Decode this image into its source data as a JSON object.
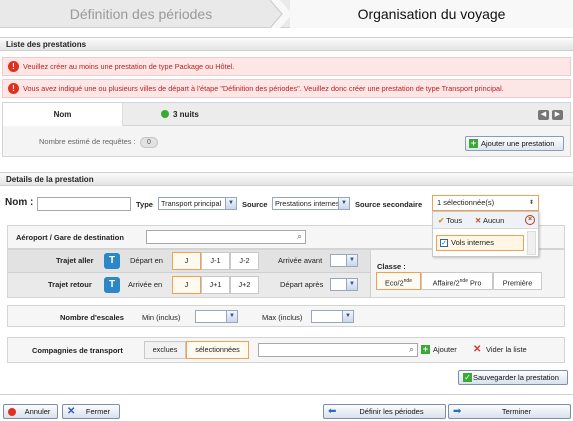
{
  "wizard": {
    "step1": "Définition des périodes",
    "step2": "Organisation du voyage"
  },
  "prestations": {
    "title": "Liste des prestations",
    "alert1": "Veuillez créer au moins une prestation de type Package ou Hôtel.",
    "alert2": "Vous avez indiqué une ou plusieurs villes de départ à l'étape \"Définition des périodes\". Veuillez donc créer une prestation de type Transport principal.",
    "col_nom": "Nom",
    "col_nuits": "3 nuits",
    "requetes_label": "Nombre estimé de requêtes :",
    "requetes_value": "0",
    "add_button": "Ajouter une prestation"
  },
  "details": {
    "title": "Details de la prestation",
    "nom_label": "Nom :",
    "nom_value": "",
    "type_label": "Type",
    "type_value": "Transport principal",
    "source_label": "Source",
    "source_value": "Prestations internes",
    "source2_label": "Source secondaire",
    "source2_value": "1 sélectionnée(s)",
    "dropdown": {
      "tous": "Tous",
      "aucun": "Aucun",
      "option1": "Vols internes"
    }
  },
  "aeroport": {
    "label": "Aéroport / Gare de destination",
    "value": ""
  },
  "trajet": {
    "aller_label": "Trajet aller",
    "retour_label": "Trajet retour",
    "depart_en": "Départ en",
    "arrivee_en": "Arrivée en",
    "aller_tabs": [
      "J",
      "J-1",
      "J-2"
    ],
    "retour_tabs": [
      "J",
      "J+1",
      "J+2"
    ],
    "arrivee_avant": "Arrivée avant",
    "depart_apres": "Départ après",
    "classe_label": "Classe :",
    "classes": [
      {
        "main": "Eco/2",
        "sup": "nde",
        "rest": ""
      },
      {
        "main": "Affaire/2",
        "sup": "nde",
        "rest": " Pro"
      },
      {
        "main": "Première",
        "sup": "",
        "rest": ""
      }
    ]
  },
  "escales": {
    "label": "Nombre d'escales",
    "min_label": "Min (inclus)",
    "max_label": "Max (inclus)"
  },
  "compagnies": {
    "label": "Compagnies de transport",
    "exclues": "exclues",
    "selectionnees": "sélectionnées",
    "ajouter": "Ajouter",
    "vider": "Vider la liste"
  },
  "save_button": "Sauvegarder la prestation",
  "footer": {
    "annuler": "Annuler",
    "fermer": "Fermer",
    "definir": "Définir les périodes",
    "terminer": "Terminer"
  },
  "colors": {
    "accent": "#2c87c8",
    "alert": "#c02020",
    "tab_active": "#f0a050"
  }
}
